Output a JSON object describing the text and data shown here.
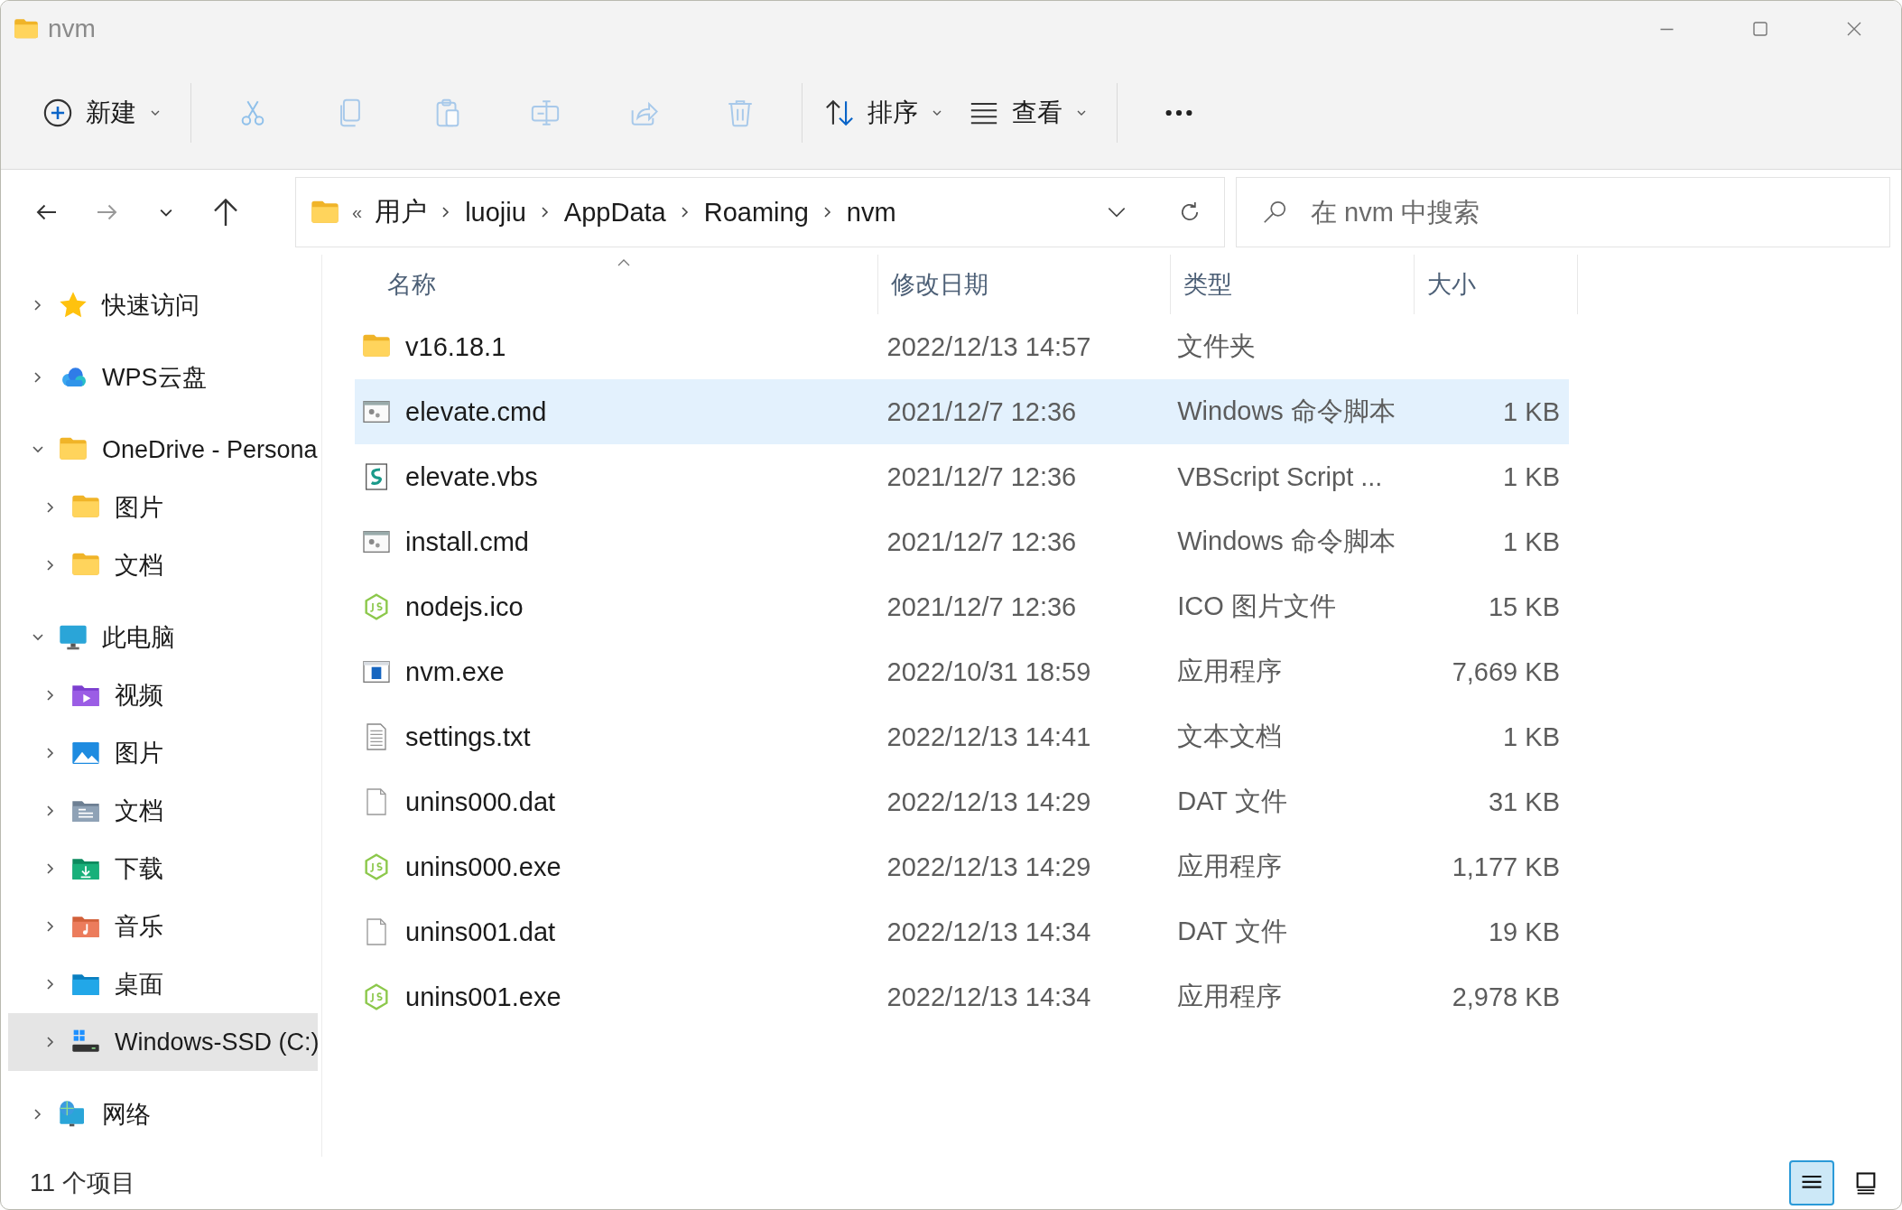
{
  "window": {
    "title": "nvm",
    "controls": [
      {
        "kind": "minimize"
      },
      {
        "kind": "maximize"
      },
      {
        "kind": "close"
      }
    ]
  },
  "toolbar": [
    {
      "kind": "new",
      "label": "新建",
      "disabled": false,
      "dropdown": true
    },
    {
      "kind": "separator"
    },
    {
      "kind": "cut",
      "disabled": true
    },
    {
      "kind": "copy",
      "disabled": true
    },
    {
      "kind": "paste",
      "disabled": true
    },
    {
      "kind": "rename",
      "disabled": true
    },
    {
      "kind": "share",
      "disabled": true
    },
    {
      "kind": "delete",
      "disabled": true
    },
    {
      "kind": "separator"
    },
    {
      "kind": "sort",
      "label": "排序",
      "disabled": false,
      "dropdown": true
    },
    {
      "kind": "view",
      "label": "查看",
      "disabled": false,
      "dropdown": true
    },
    {
      "kind": "separator"
    },
    {
      "kind": "more",
      "disabled": false
    }
  ],
  "navigation": [
    {
      "kind": "back",
      "disabled": false
    },
    {
      "kind": "forward",
      "disabled": true
    },
    {
      "kind": "recent",
      "disabled": false
    },
    {
      "kind": "up",
      "disabled": false
    }
  ],
  "address_bar": {
    "overflow": "«",
    "path": [
      "用户",
      "luojiu",
      "AppData",
      "Roaming",
      "nvm"
    ]
  },
  "search": {
    "placeholder": "在 nvm 中搜索"
  },
  "sidebar": {
    "items": [
      {
        "label": "快速访问",
        "kind": "star",
        "expanded": false,
        "selected": false
      },
      {
        "label": "WPS云盘",
        "kind": "cloud",
        "expanded": false,
        "selected": false
      },
      {
        "label": "OneDrive - Persona",
        "kind": "folder",
        "expanded": true,
        "selected": false,
        "children": [
          {
            "label": "图片",
            "kind": "folder",
            "expanded": false,
            "selected": false
          },
          {
            "label": "文档",
            "kind": "folder",
            "expanded": false,
            "selected": false
          }
        ]
      },
      {
        "label": "此电脑",
        "kind": "pc",
        "expanded": true,
        "selected": false,
        "children": [
          {
            "label": "视频",
            "kind": "video",
            "expanded": false,
            "selected": false
          },
          {
            "label": "图片",
            "kind": "pictures",
            "expanded": false,
            "selected": false
          },
          {
            "label": "文档",
            "kind": "documents",
            "expanded": false,
            "selected": false
          },
          {
            "label": "下载",
            "kind": "download",
            "expanded": false,
            "selected": false
          },
          {
            "label": "音乐",
            "kind": "music",
            "expanded": false,
            "selected": false
          },
          {
            "label": "桌面",
            "kind": "desktop",
            "expanded": false,
            "selected": false
          },
          {
            "label": "Windows-SSD (C:)",
            "kind": "drive",
            "expanded": false,
            "selected": true
          }
        ]
      },
      {
        "label": "网络",
        "kind": "network",
        "expanded": false,
        "selected": false
      }
    ]
  },
  "table": {
    "columns": [
      {
        "label": "名称",
        "sorted": true
      },
      {
        "label": "修改日期",
        "sorted": false
      },
      {
        "label": "类型",
        "sorted": false
      },
      {
        "label": "大小",
        "sorted": false
      }
    ],
    "rows": [
      {
        "kind": "folder",
        "name": "v16.18.1",
        "date": "2022/12/13 14:57",
        "type": "文件夹",
        "selected": false
      },
      {
        "kind": "script",
        "name": "elevate.cmd",
        "date": "2021/12/7 12:36",
        "type": "Windows 命令脚本",
        "size": "1 KB",
        "selected": true
      },
      {
        "kind": "vbs",
        "name": "elevate.vbs",
        "date": "2021/12/7 12:36",
        "type": "VBScript Script ...",
        "size": "1 KB",
        "selected": false
      },
      {
        "kind": "script",
        "name": "install.cmd",
        "date": "2021/12/7 12:36",
        "type": "Windows 命令脚本",
        "size": "1 KB",
        "selected": false
      },
      {
        "kind": "node",
        "name": "nodejs.ico",
        "date": "2021/12/7 12:36",
        "type": "ICO 图片文件",
        "size": "15 KB",
        "selected": false
      },
      {
        "kind": "app",
        "name": "nvm.exe",
        "date": "2022/10/31 18:59",
        "type": "应用程序",
        "size": "7,669 KB",
        "selected": false
      },
      {
        "kind": "text",
        "name": "settings.txt",
        "date": "2022/12/13 14:41",
        "type": "文本文档",
        "size": "1 KB",
        "selected": false
      },
      {
        "kind": "blank",
        "name": "unins000.dat",
        "date": "2022/12/13 14:29",
        "type": "DAT 文件",
        "size": "31 KB",
        "selected": false
      },
      {
        "kind": "node",
        "name": "unins000.exe",
        "date": "2022/12/13 14:29",
        "type": "应用程序",
        "size": "1,177 KB",
        "selected": false
      },
      {
        "kind": "blank",
        "name": "unins001.dat",
        "date": "2022/12/13 14:34",
        "type": "DAT 文件",
        "size": "19 KB",
        "selected": false
      },
      {
        "kind": "node",
        "name": "unins001.exe",
        "date": "2022/12/13 14:34",
        "type": "应用程序",
        "size": "2,978 KB",
        "selected": false
      }
    ]
  },
  "status_bar": {
    "text": "11 个项目",
    "views": [
      {
        "kind": "details",
        "selected": true
      },
      {
        "kind": "tiles",
        "selected": false
      }
    ]
  }
}
